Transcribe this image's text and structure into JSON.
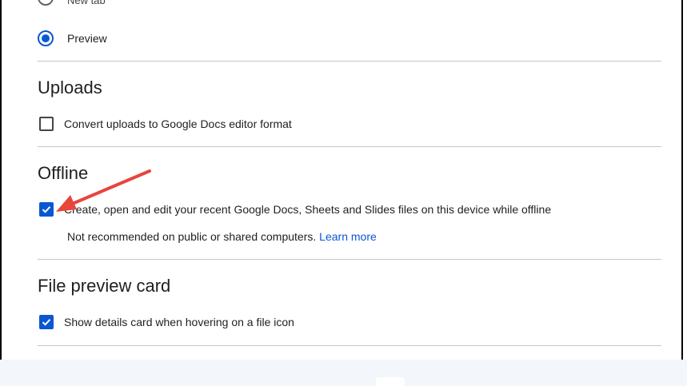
{
  "open_files": {
    "options": [
      {
        "label": "New tab",
        "checked": false
      },
      {
        "label": "Preview",
        "checked": true
      }
    ]
  },
  "uploads": {
    "heading": "Uploads",
    "convert_label": "Convert uploads to Google Docs editor format",
    "convert_checked": false
  },
  "offline": {
    "heading": "Offline",
    "label": "Create, open and edit your recent Google Docs, Sheets and Slides files on this device while offline",
    "checked": true,
    "note": "Not recommended on public or shared computers.",
    "learn_more": "Learn more"
  },
  "file_preview_card": {
    "heading": "File preview card",
    "label": "Show details card when hovering on a file icon",
    "checked": true
  },
  "colors": {
    "accent": "#0b57d0",
    "annotation_arrow": "#e8453c"
  }
}
